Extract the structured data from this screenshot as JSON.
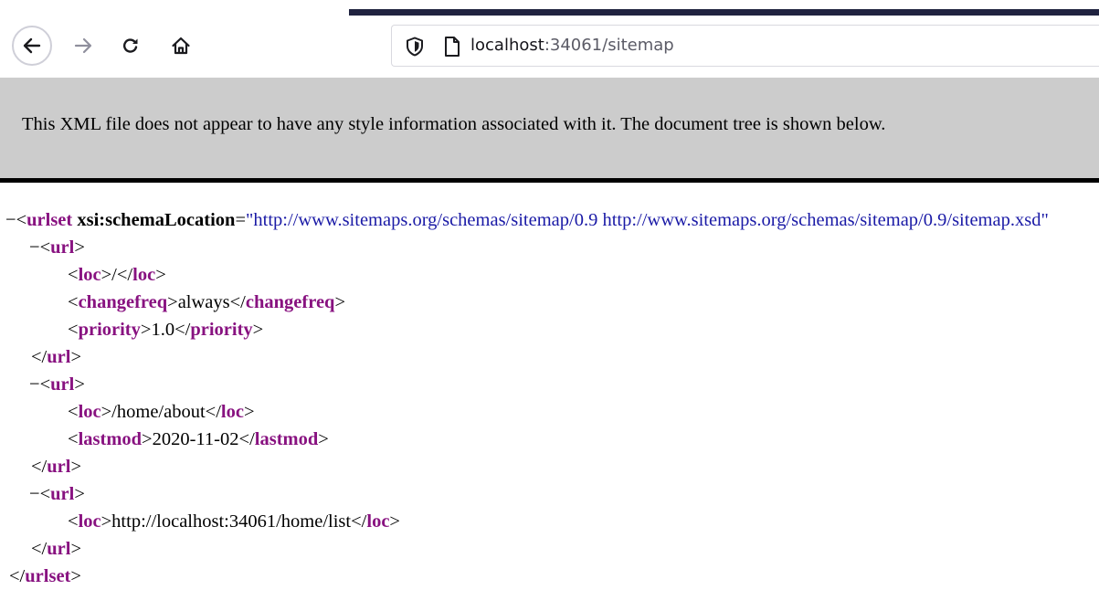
{
  "browser": {
    "address": {
      "host": "localhost",
      "rest": ":34061/sitemap"
    },
    "icons": [
      "back-arrow-icon",
      "forward-arrow-icon",
      "reload-icon",
      "home-icon",
      "shield-icon",
      "page-icon"
    ]
  },
  "notice": {
    "text": "This XML file does not appear to have any style information associated with it. The document tree is shown below."
  },
  "tree": {
    "fold_symbol": "−",
    "urlset_tag": "urlset",
    "attr_name": "xsi:schemaLocation",
    "attr_value": "\"http://www.sitemaps.org/schemas/sitemap/0.9 http://www.sitemaps.org/schemas/sitemap/0.9/sitemap.xsd\"",
    "url_tag": "url",
    "urls": [
      {
        "children": [
          {
            "tag": "loc",
            "value": "/"
          },
          {
            "tag": "changefreq",
            "value": "always"
          },
          {
            "tag": "priority",
            "value": "1.0"
          }
        ]
      },
      {
        "children": [
          {
            "tag": "loc",
            "value": "/home/about"
          },
          {
            "tag": "lastmod",
            "value": "2020-11-02"
          }
        ]
      },
      {
        "children": [
          {
            "tag": "loc",
            "value": "http://localhost:34061/home/list"
          }
        ]
      }
    ]
  }
}
